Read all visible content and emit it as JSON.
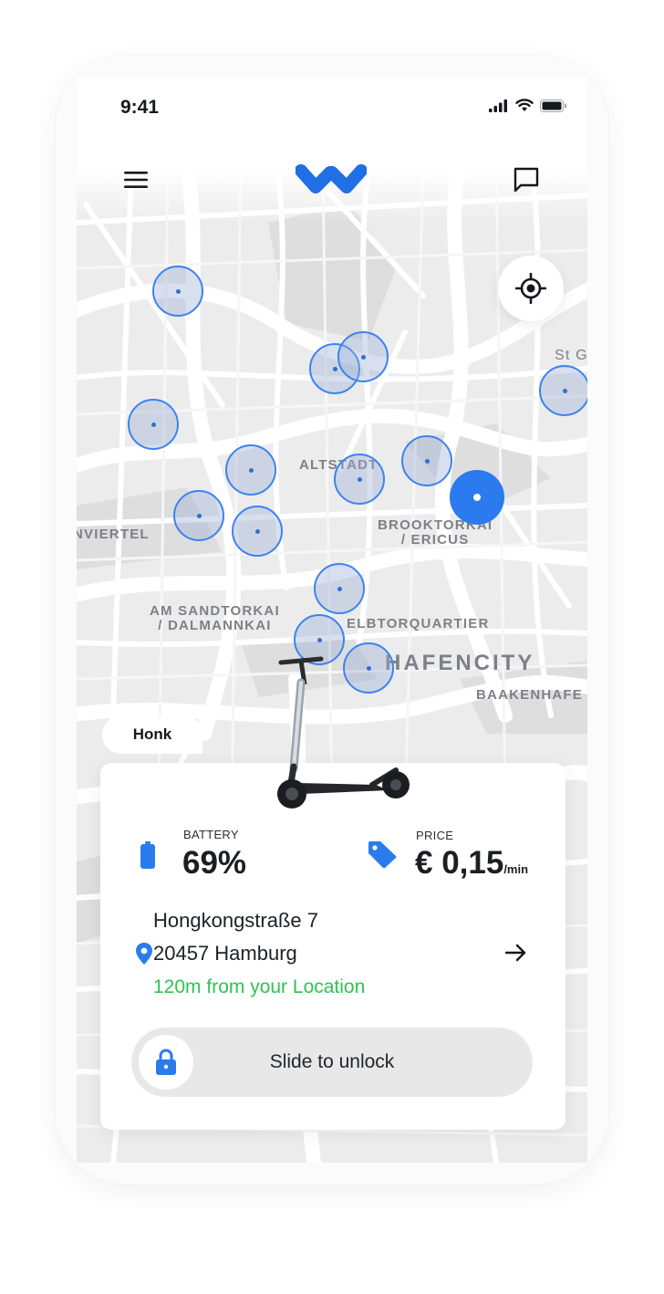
{
  "status_bar": {
    "time": "9:41"
  },
  "nav": {
    "menu_icon": "hamburger-icon",
    "logo_icon": "brand-w-logo",
    "chat_icon": "chat-bubble-icon"
  },
  "map": {
    "labels": {
      "altstadt": "ALTSTADT",
      "brooktorkai": "BROOKTORKAI\n/ ERICUS",
      "viertel": "NVIERTEL",
      "sandtorkai": "AM SANDTORKAI\n/ DALMANNKAI",
      "elbtorquartier": "ELBTORQUARTIER",
      "hafencity": "HAFENCITY",
      "baakenhafen": "BAAKENHAFE",
      "stg": "St G"
    },
    "locate_icon": "crosshair-icon"
  },
  "vehicle": {
    "name": "Honk",
    "battery_label": "BATTERY",
    "battery_value": "69%",
    "battery_level": 0.69,
    "price_label": "PRICE",
    "price_value": "€ 0,15",
    "price_unit": "/min",
    "address_street": "Hongkongstraße 7",
    "address_city": "20457 Hamburg",
    "distance": "120m from your Location",
    "unlock_label": "Slide to unlock"
  },
  "colors": {
    "accent": "#2b7bef",
    "success": "#2fc451",
    "map_bg": "#ececec",
    "road": "#ffffff"
  }
}
